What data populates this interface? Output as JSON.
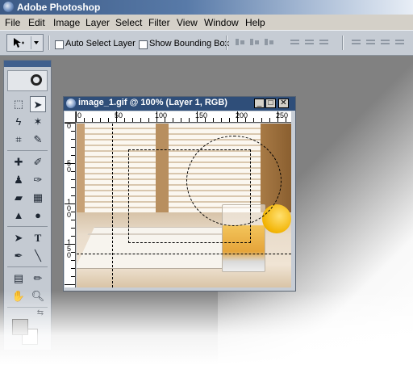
{
  "app": {
    "title": "Adobe Photoshop"
  },
  "menu": [
    "File",
    "Edit",
    "Image",
    "Layer",
    "Select",
    "Filter",
    "View",
    "Window",
    "Help"
  ],
  "options": {
    "auto_select_label": "Auto Select Layer",
    "auto_select_checked": false,
    "show_bbox_label": "Show Bounding Box",
    "show_bbox_checked": false
  },
  "document": {
    "title": "image_1.gif @ 100% (Layer 1, RGB)",
    "ruler_top_labels": [
      "0",
      "50",
      "100",
      "150",
      "200",
      "250"
    ],
    "ruler_left_labels": [
      "0",
      "5\n0",
      "1\n0\n0",
      "1\n5\n0"
    ]
  },
  "toolbox": {
    "tools": [
      "rectangular-marquee",
      "move",
      "lasso",
      "magic-wand",
      "crop",
      "slice",
      "healing-brush",
      "brush",
      "clone-stamp",
      "history-brush",
      "eraser",
      "gradient",
      "blur",
      "dodge",
      "path-selection",
      "type",
      "pen",
      "line",
      "notes",
      "eyedropper",
      "hand",
      "zoom"
    ]
  },
  "colors": {
    "accent": "#2f4e79",
    "foreground": "#888888",
    "background": "#ffffff"
  }
}
